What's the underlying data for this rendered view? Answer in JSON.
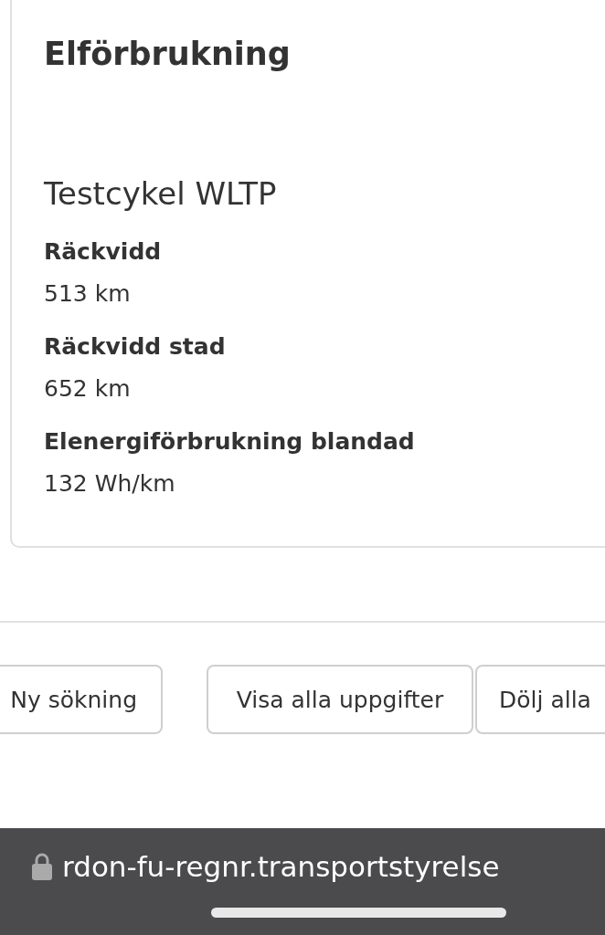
{
  "card": {
    "title": "Elförbrukning",
    "subtitle": "Testcykel WLTP",
    "fields": [
      {
        "label": "Räckvidd",
        "value": "513 km"
      },
      {
        "label": "Räckvidd stad",
        "value": "652 km"
      },
      {
        "label": "Elenergiförbrukning blandad",
        "value": "132 Wh/km"
      }
    ]
  },
  "buttons": [
    "Ny sökning",
    "Visa alla uppgifter",
    "Dölj alla"
  ],
  "browser_bar": {
    "url": "rdon-fu-regnr.transportstyrelse"
  }
}
